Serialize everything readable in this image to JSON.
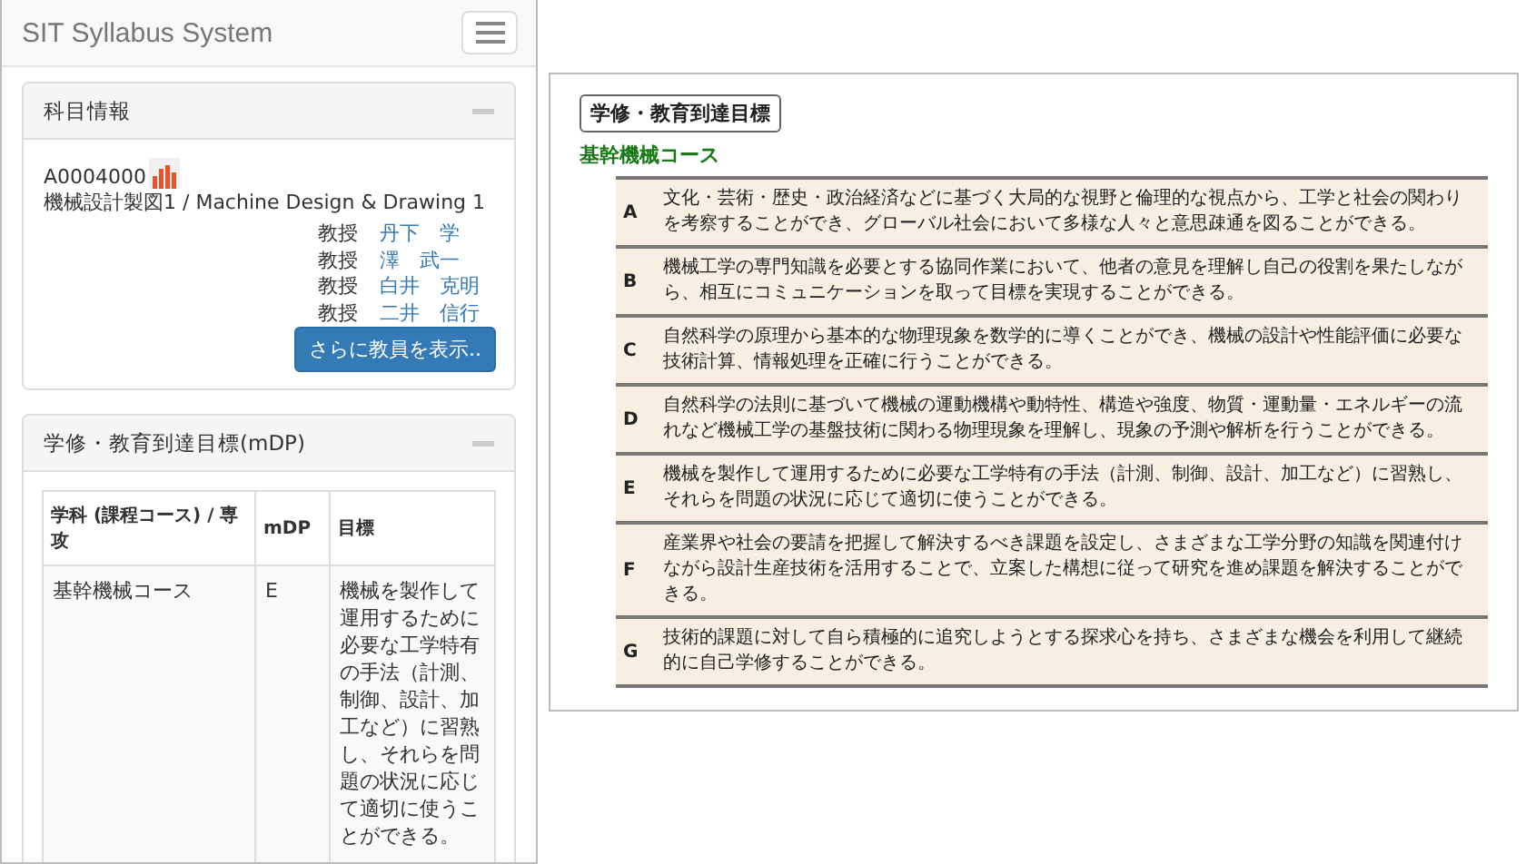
{
  "app": {
    "title": "SIT Syllabus System"
  },
  "course_panel": {
    "title": "科目情報",
    "code": "A0004000",
    "name": "機械設計製図1 / Machine Design & Drawing 1",
    "instructors": [
      {
        "title": "教授",
        "name": "丹下　学"
      },
      {
        "title": "教授",
        "name": "澤　武一"
      },
      {
        "title": "教授",
        "name": "白井　克明"
      },
      {
        "title": "教授",
        "name": "二井　信行"
      }
    ],
    "more_button": "さらに教員を表示.."
  },
  "mdp_panel": {
    "title": "学修・教育到達目標(mDP)",
    "columns": [
      "学科 (課程コース) / 専攻",
      "mDP",
      "目標"
    ],
    "rows": [
      [
        "基幹機械コース",
        "E",
        "機械を製作して運用するために必要な工学特有の手法（計測、制御、設計、加工など）に習熟し、それらを問題の状況に応じて適切に使うことができる。"
      ]
    ]
  },
  "goals_document": {
    "title": "学修・教育到達目標",
    "course": "基幹機械コース",
    "rows": [
      {
        "letter": "A",
        "text": "文化・芸術・歴史・政治経済などに基づく大局的な視野と倫理的な視点から、工学と社会の関わりを考察することができ、グローバル社会において多様な人々と意思疎通を図ることができる。"
      },
      {
        "letter": "B",
        "text": "機械工学の専門知識を必要とする協同作業において、他者の意見を理解し自己の役割を果たしながら、相互にコミュニケーションを取って目標を実現することができる。"
      },
      {
        "letter": "C",
        "text": "自然科学の原理から基本的な物理現象を数学的に導くことができ、機械の設計や性能評価に必要な技術計算、情報処理を正確に行うことができる。"
      },
      {
        "letter": "D",
        "text": "自然科学の法則に基づいて機械の運動機構や動特性、構造や強度、物質・運動量・エネルギーの流れなど機械工学の基盤技術に関わる物理現象を理解し、現象の予測や解析を行うことができる。"
      },
      {
        "letter": "E",
        "text": "機械を製作して運用するために必要な工学特有の手法（計測、制御、設計、加工など）に習熟し、それらを問題の状況に応じて適切に使うことができる。"
      },
      {
        "letter": "F",
        "text": "産業界や社会の要請を把握して解決するべき課題を設定し、さまざまな工学分野の知識を関連付けながら設計生産技術を活用することで、立案した構想に従って研究を進め課題を解決することができる。"
      },
      {
        "letter": "G",
        "text": "技術的課題に対して自ら積極的に追究しようとする探求心を持ち、さまざまな機会を利用して継続的に自己学修することができる。"
      }
    ]
  }
}
